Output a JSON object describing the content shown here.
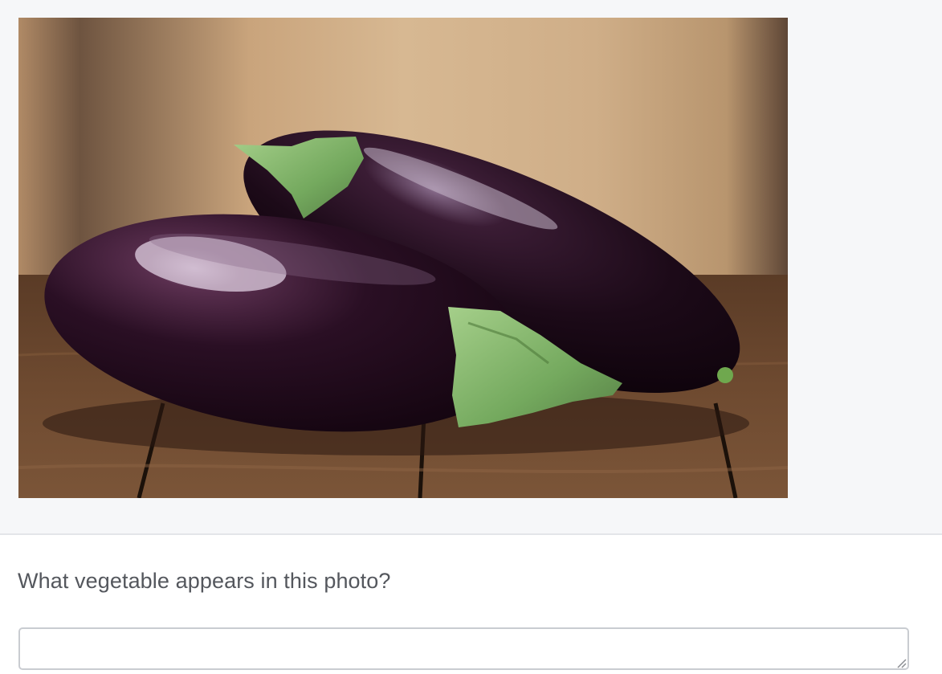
{
  "image": {
    "subject_icon": "eggplant-photo"
  },
  "question": {
    "text": "What vegetable appears in this photo?"
  },
  "answer": {
    "value": "",
    "placeholder": ""
  },
  "colors": {
    "page_bg": "#f6f7f9",
    "question_text": "#54575d",
    "input_border": "#c9ccd1"
  }
}
